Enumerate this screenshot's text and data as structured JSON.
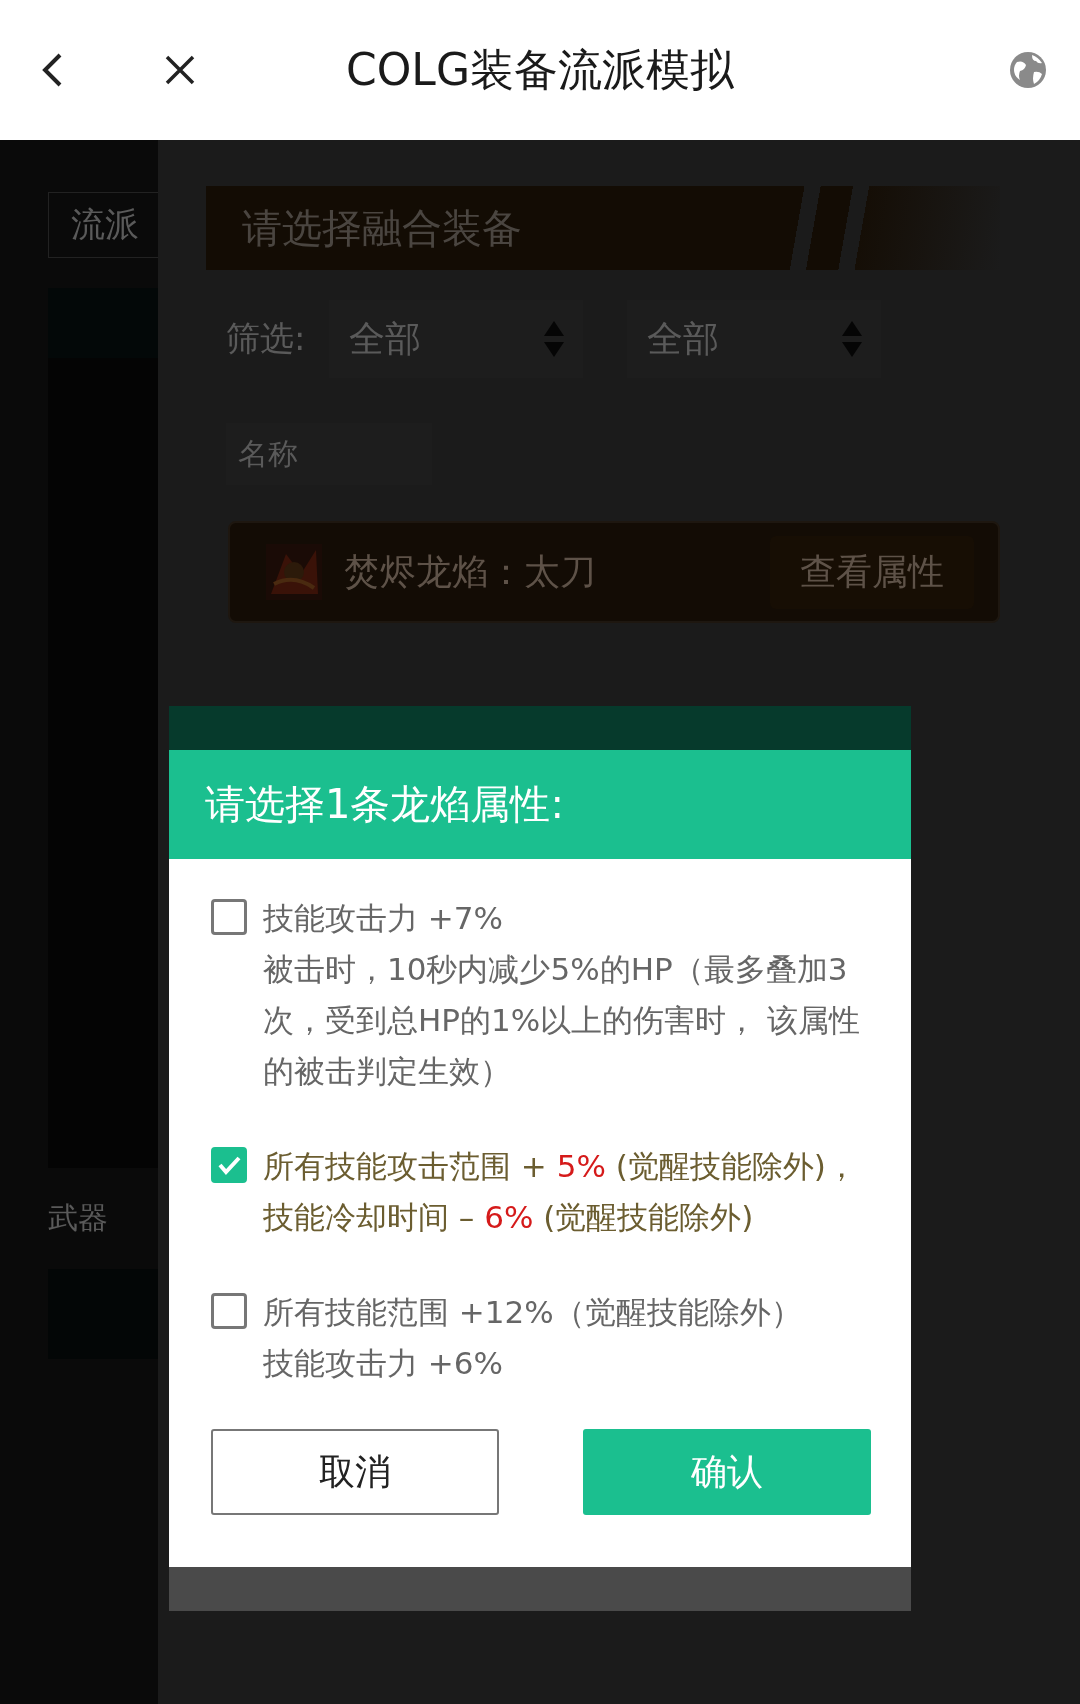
{
  "header": {
    "title": "COLG装备流派模拟"
  },
  "background": {
    "sidebar": {
      "top_button": "流派",
      "label": "武器"
    },
    "panel": {
      "banner": "请选择融合装备",
      "filter_label": "筛选:",
      "selects": [
        {
          "value": "全部"
        },
        {
          "value": "全部"
        }
      ],
      "name_label": "名称",
      "item": {
        "name": "焚烬龙焰：太刀",
        "button": "查看属性"
      }
    }
  },
  "dialog": {
    "title": "请选择1条龙焰属性:",
    "options": [
      {
        "checked": false,
        "paragraphs": [
          [
            {
              "text": "技能攻击力 +7%",
              "kind": "text"
            }
          ],
          [
            {
              "text": "被击时，10秒内减少5%的HP（最多叠加3次，受到总HP的1%以上的伤害时， 该属性的被击判定生效）",
              "kind": "text"
            }
          ]
        ]
      },
      {
        "checked": true,
        "paragraphs": [
          [
            {
              "text": "所有技能攻击范围 + ",
              "kind": "text"
            },
            {
              "text": "5%",
              "kind": "value"
            },
            {
              "text": " (觉醒技能除外)，技能冷却时间 – ",
              "kind": "text"
            },
            {
              "text": "6%",
              "kind": "value"
            },
            {
              "text": " (觉醒技能除外)",
              "kind": "text"
            }
          ]
        ]
      },
      {
        "checked": false,
        "paragraphs": [
          [
            {
              "text": "所有技能范围 +12%（觉醒技能除外）",
              "kind": "text"
            }
          ],
          [
            {
              "text": "技能攻击力 +6%",
              "kind": "text"
            }
          ]
        ]
      }
    ],
    "buttons": [
      {
        "label": "取消",
        "kind": "secondary"
      },
      {
        "label": "确认",
        "kind": "primary"
      }
    ]
  }
}
